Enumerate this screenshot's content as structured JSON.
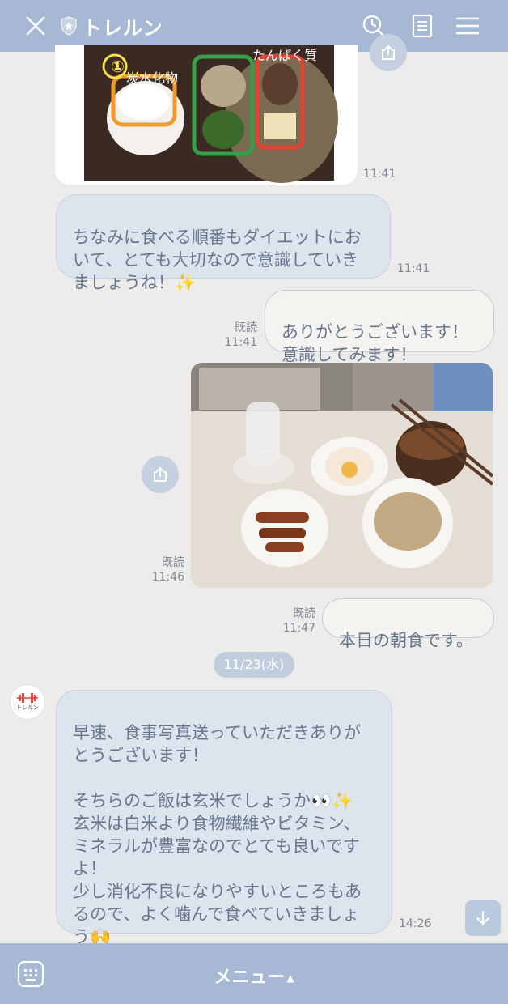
{
  "header": {
    "title": "トレルン"
  },
  "messages": {
    "top_photo": {
      "label_1": "炭水化物",
      "label_2": "たんぱく質",
      "number": "①",
      "time": "11:41"
    },
    "msg1": {
      "text": "ちなみに食べる順番もダイエットにおいて、とても大切なので意識していきましょうね！✨",
      "time": "11:41"
    },
    "msg2": {
      "text": "ありがとうございます！\n意識してみます！",
      "read": "既読",
      "time": "11:41"
    },
    "photo2": {
      "read": "既読",
      "time": "11:46"
    },
    "msg3": {
      "text": "本日の朝食です。",
      "read": "既読",
      "time": "11:47"
    },
    "date_chip": "11/23(水)",
    "avatar_text": "トレルン",
    "msg4": {
      "text": "早速、食事写真送っていただきありがとうございます！\n\nそちらのご飯は玄米でしょうか👀✨\n玄米は白米より食物繊維やビタミン、ミネラルが豊富なのでとても良いですよ！\n少し消化不良になりやすいところもあるので、よく噛んで食べていきましょう🙌",
      "time": "14:26"
    }
  },
  "footer": {
    "menu_label": "メニュー",
    "menu_arrow": "▲"
  },
  "colors": {
    "header_bg": "#a6b8d3",
    "chat_bg": "#edecea",
    "incoming_bubble": "#dde4ee",
    "outgoing_bubble": "#f4f3f0"
  }
}
